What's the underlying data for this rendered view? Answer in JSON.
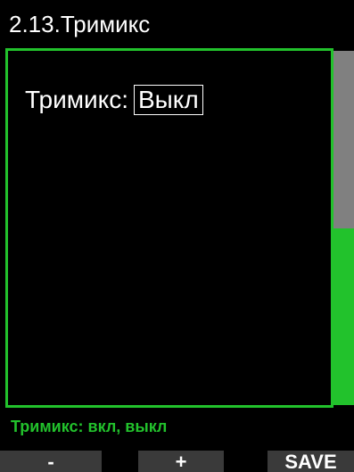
{
  "header": {
    "title": "2.13.Тримикс"
  },
  "setting": {
    "label": "Тримикс:",
    "value": "Выкл"
  },
  "hint": {
    "text": "Тримикс: вкл, выкл"
  },
  "softkeys": {
    "minus": "-",
    "plus": "+",
    "save": "SAVE"
  },
  "colors": {
    "accent": "#22c22c",
    "background": "#000000",
    "scroll_thumb": "#808080",
    "softkey_bg": "#3a3a3a"
  },
  "scroll": {
    "position_fraction": 0.0,
    "visible_fraction": 0.5
  }
}
